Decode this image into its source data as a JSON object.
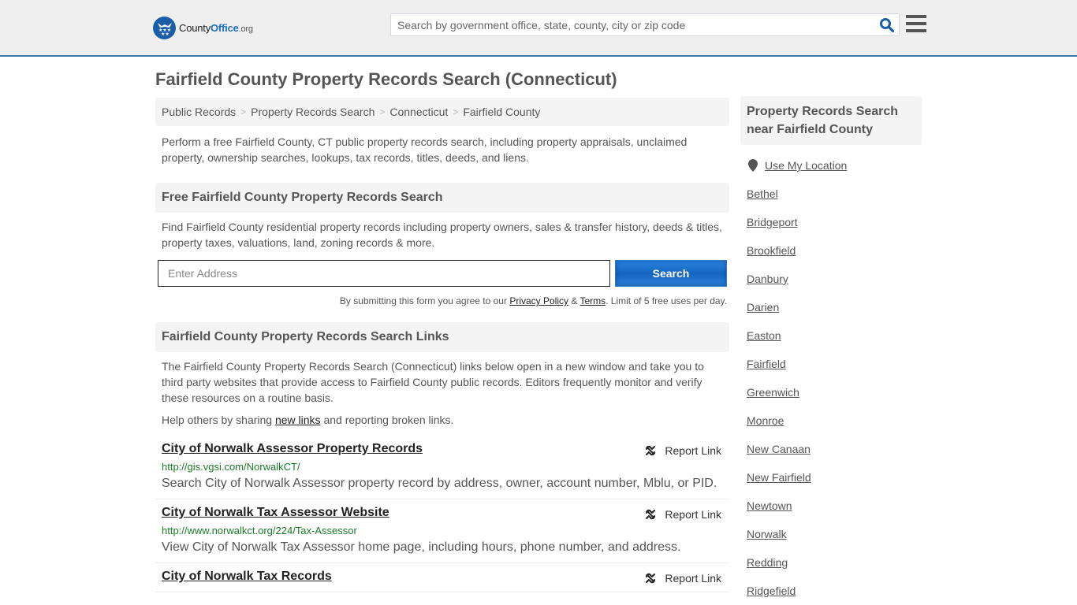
{
  "header": {
    "logo": {
      "prefix": "County",
      "brand": "Office",
      "tld": ".org"
    },
    "search_placeholder": "Search by government office, state, county, city or zip code",
    "search_icon": "magnifier-icon",
    "menu_icon": "hamburger-icon",
    "accent_color": "#3a7cb0"
  },
  "page": {
    "title": "Fairfield County Property Records Search (Connecticut)"
  },
  "breadcrumb": {
    "items": [
      "Public Records",
      "Property Records Search",
      "Connecticut",
      "Fairfield County"
    ],
    "separator": ">"
  },
  "intro": "Perform a free Fairfield County, CT public property records search, including property appraisals, unclaimed property, ownership searches, lookups, tax records, titles, deeds, and liens.",
  "free_search": {
    "heading": "Free Fairfield County Property Records Search",
    "text": "Find Fairfield County residential property records including property owners, sales & transfer history, deeds & titles, property taxes, valuations, land, zoning records & more.",
    "address_placeholder": "Enter Address",
    "address_value": "",
    "button_label": "Search",
    "disclaimer_prefix": "By submitting this form you agree to our ",
    "privacy_label": "Privacy Policy",
    "amp": " & ",
    "terms_label": "Terms",
    "disclaimer_suffix": ". Limit of 5 free uses per day."
  },
  "links_section": {
    "heading": "Fairfield County Property Records Search Links",
    "text": "The Fairfield County Property Records Search (Connecticut) links below open in a new window and take you to third party websites that provide access to Fairfield County public records. Editors frequently monitor and verify these resources on a routine basis.",
    "help_prefix": "Help others by sharing ",
    "help_link": "new links",
    "help_suffix": " and reporting broken links.",
    "report_label": "Report Link",
    "results": [
      {
        "title": "City of Norwalk Assessor Property Records",
        "url": "http://gis.vgsi.com/NorwalkCT/",
        "description": "Search City of Norwalk Assessor property record by address, owner, account number, Mblu, or PID."
      },
      {
        "title": "City of Norwalk Tax Assessor Website",
        "url": "http://www.norwalkct.org/224/Tax-Assessor",
        "description": "View City of Norwalk Tax Assessor home page, including hours, phone number, and address."
      },
      {
        "title": "City of Norwalk Tax Records",
        "url": "",
        "description": ""
      }
    ]
  },
  "sidebar": {
    "heading": "Property Records Search near Fairfield County",
    "use_location": "Use My Location",
    "cities": [
      "Bethel",
      "Bridgeport",
      "Brookfield",
      "Danbury",
      "Darien",
      "Easton",
      "Fairfield",
      "Greenwich",
      "Monroe",
      "New Canaan",
      "New Fairfield",
      "Newtown",
      "Norwalk",
      "Redding",
      "Ridgefield"
    ]
  }
}
